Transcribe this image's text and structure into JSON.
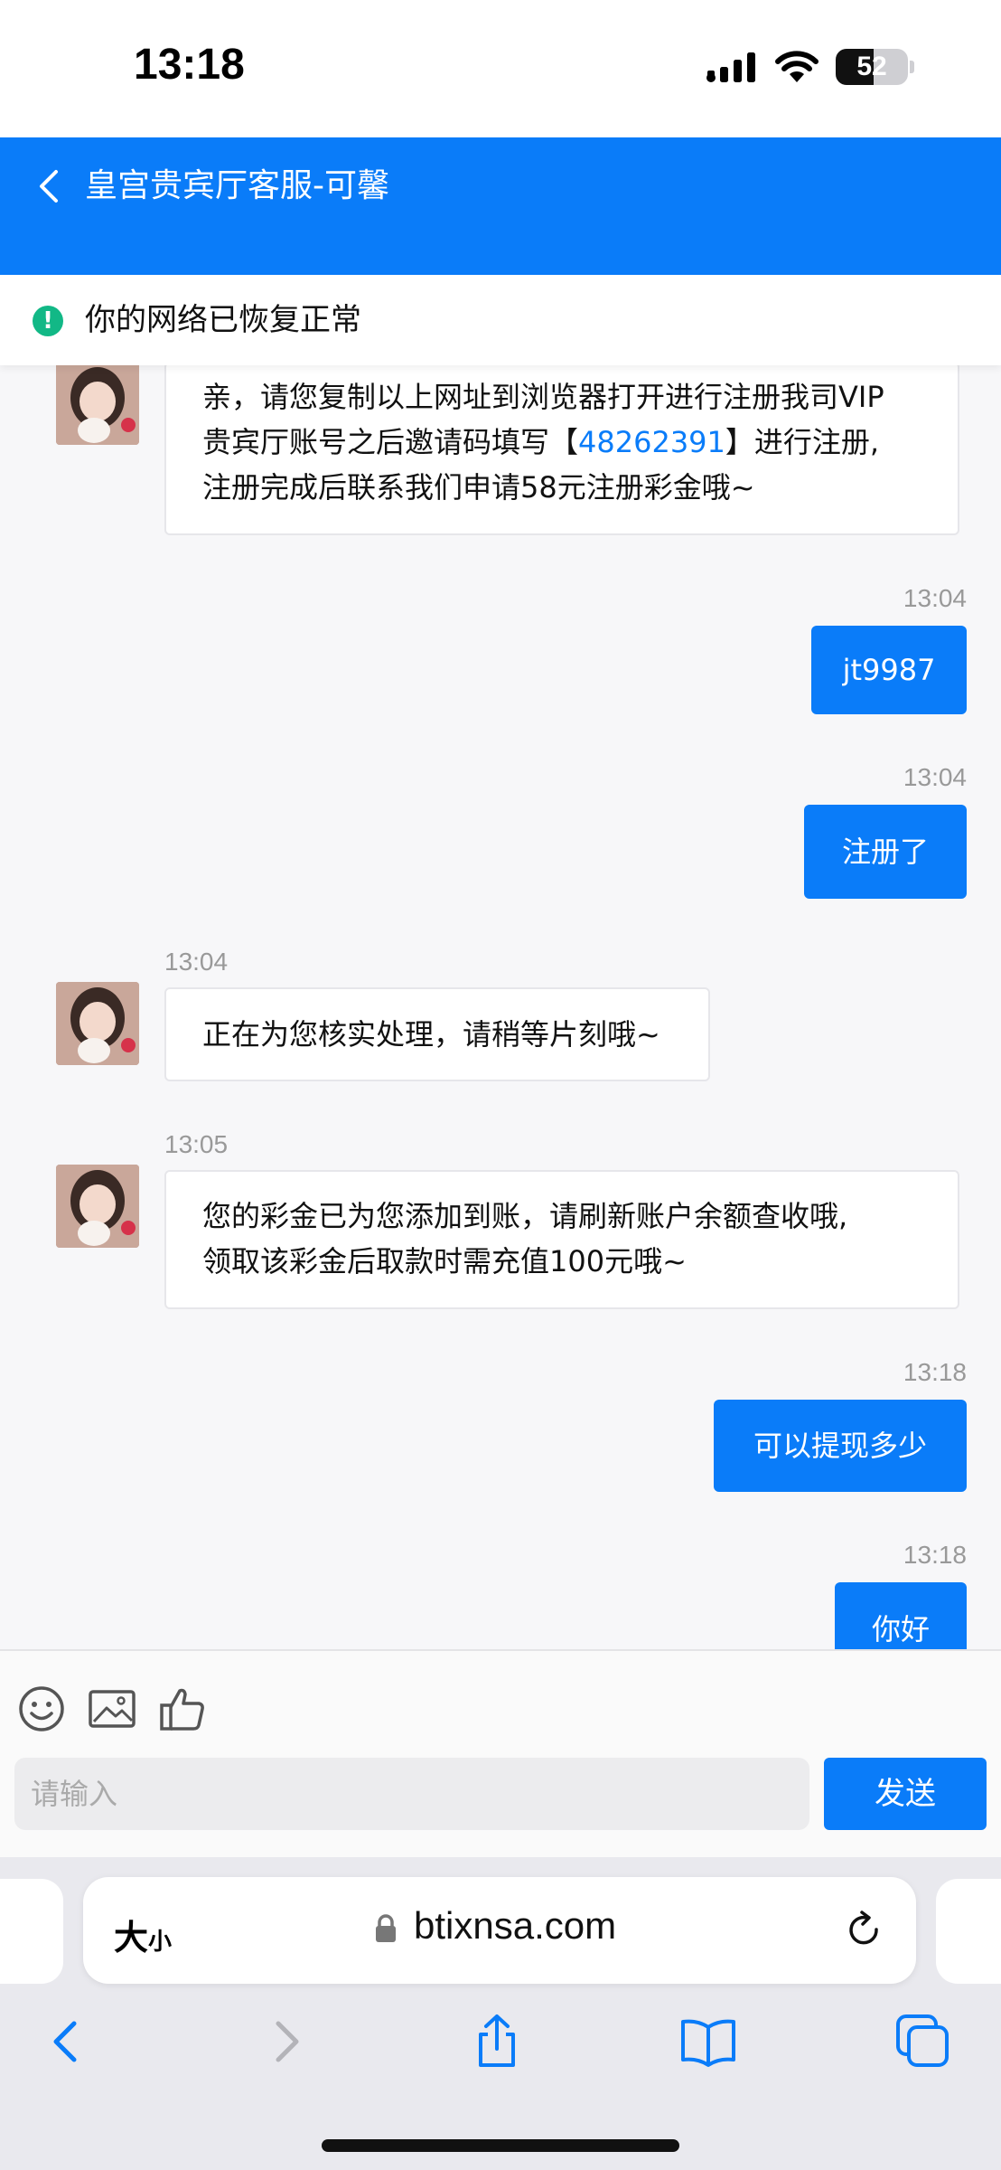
{
  "status_bar": {
    "time": "13:18",
    "battery": "52",
    "battery_level_pct": 52
  },
  "header": {
    "title": "皇宫贵宾厅客服-可馨"
  },
  "network_banner": {
    "text": "你的网络已恢复正常",
    "icon": "exclamation-icon",
    "icon_char": "!"
  },
  "messages": [
    {
      "sender": "agent",
      "lines": [
        {
          "before": "亲，请您复制以上网址到浏览器打开进行注册我司VIP",
          "link": "",
          "after": ""
        },
        {
          "before": "贵宾厅账号之后邀请码填写【",
          "link": "48262391",
          "after": "】进行注册,"
        },
        {
          "before": "注册完成后联系我们申请58元注册彩金哦~",
          "link": "",
          "after": ""
        }
      ]
    },
    {
      "sender": "user",
      "time": "13:04",
      "text": "jt9987"
    },
    {
      "sender": "user",
      "time": "13:04",
      "text": "注册了"
    },
    {
      "sender": "agent",
      "time": "13:04",
      "text": "正在为您核实处理，请稍等片刻哦~"
    },
    {
      "sender": "agent",
      "time": "13:05",
      "line1": "您的彩金已为您添加到账，请刷新账户余额查收哦,",
      "line2": "领取该彩金后取款时需充值100元哦~"
    },
    {
      "sender": "user",
      "time": "13:18",
      "text": "可以提现多少"
    },
    {
      "sender": "user",
      "time": "13:18",
      "text": "你好"
    }
  ],
  "composer": {
    "placeholder": "请输入",
    "send_label": "发送",
    "tools": [
      "emoji-icon",
      "image-icon",
      "thumbs-up-icon"
    ]
  },
  "safari": {
    "text_size_big": "大",
    "text_size_small": "小",
    "url": "btixnsa.com"
  },
  "colors": {
    "accent": "#0a7cf9",
    "success": "#12b886"
  }
}
